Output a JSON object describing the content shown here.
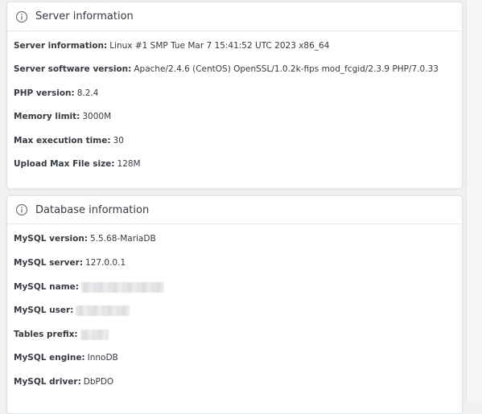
{
  "server_card": {
    "title": "Server information",
    "icon": "info-circle-icon",
    "rows": [
      {
        "label": "Server information:",
        "value": "Linux #1 SMP Tue Mar 7 15:41:52 UTC 2023 x86_64"
      },
      {
        "label": "Server software version:",
        "value": "Apache/2.4.6 (CentOS) OpenSSL/1.0.2k-fips mod_fcgid/2.3.9 PHP/7.0.33"
      },
      {
        "label": "PHP version:",
        "value": "8.2.4"
      },
      {
        "label": "Memory limit:",
        "value": "3000M"
      },
      {
        "label": "Max execution time:",
        "value": "30"
      },
      {
        "label": "Upload Max File size:",
        "value": "128M"
      }
    ]
  },
  "db_card": {
    "title": "Database information",
    "icon": "info-circle-icon",
    "rows": [
      {
        "label": "MySQL version:",
        "value": "5.5.68-MariaDB"
      },
      {
        "label": "MySQL server:",
        "value": "127.0.0.1"
      },
      {
        "label": "MySQL name:",
        "value": ""
      },
      {
        "label": "MySQL user:",
        "value": ""
      },
      {
        "label": "Tables prefix:",
        "value": ""
      },
      {
        "label": "MySQL engine:",
        "value": "InnoDB"
      },
      {
        "label": "MySQL driver:",
        "value": "DbPDO"
      }
    ]
  },
  "colors": {
    "background": "#eff1f3",
    "card": "#ffffff",
    "text": "#363a41"
  }
}
